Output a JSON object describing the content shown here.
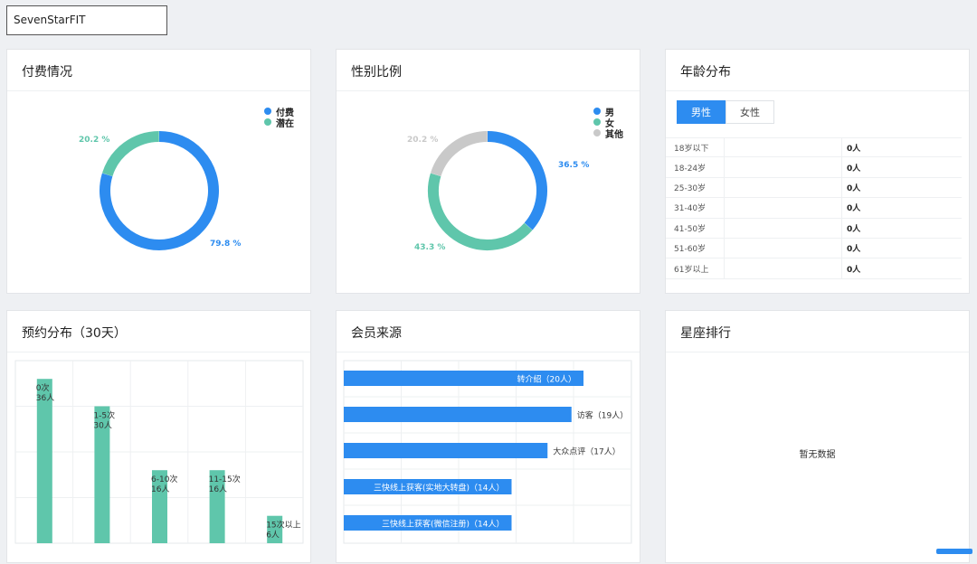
{
  "app": {
    "name": "SevenStarFIT"
  },
  "colors": {
    "blue": "#2d8cf0",
    "teal": "#5fc6ab",
    "gray": "#c9c9c9"
  },
  "payment": {
    "title": "付费情况",
    "legend": [
      {
        "label": "付费",
        "color": "#2d8cf0"
      },
      {
        "label": "潜在",
        "color": "#5fc6ab"
      }
    ],
    "labels": {
      "paid": "79.8 %",
      "potential": "20.2 %"
    },
    "chart_data": {
      "type": "pie",
      "categories": [
        "付费",
        "潜在"
      ],
      "values": [
        79.8,
        20.2
      ]
    }
  },
  "gender": {
    "title": "性别比例",
    "legend": [
      {
        "label": "男",
        "color": "#2d8cf0"
      },
      {
        "label": "女",
        "color": "#5fc6ab"
      },
      {
        "label": "其他",
        "color": "#c9c9c9"
      }
    ],
    "labels": {
      "male": "36.5 %",
      "female": "43.3 %",
      "other": "20.2 %"
    },
    "chart_data": {
      "type": "pie",
      "categories": [
        "男",
        "女",
        "其他"
      ],
      "values": [
        36.5,
        43.3,
        20.2
      ]
    }
  },
  "age": {
    "title": "年龄分布",
    "tabs": [
      {
        "label": "男性",
        "active": true
      },
      {
        "label": "女性",
        "active": false
      }
    ],
    "rows": [
      {
        "range": "18岁以下",
        "count": "0人"
      },
      {
        "range": "18-24岁",
        "count": "0人"
      },
      {
        "range": "25-30岁",
        "count": "0人"
      },
      {
        "range": "31-40岁",
        "count": "0人"
      },
      {
        "range": "41-50岁",
        "count": "0人"
      },
      {
        "range": "51-60岁",
        "count": "0人"
      },
      {
        "range": "61岁以上",
        "count": "0人"
      }
    ]
  },
  "booking": {
    "title": "预约分布（30天）",
    "chart_data": {
      "type": "bar",
      "categories": [
        "0次",
        "1-5次",
        "6-10次",
        "11-15次",
        "15次以上"
      ],
      "values": [
        36,
        30,
        16,
        16,
        6
      ],
      "value_labels": [
        "36人",
        "30人",
        "16人",
        "16人",
        "6人"
      ],
      "ylim": [
        0,
        40
      ]
    }
  },
  "source": {
    "title": "会员来源",
    "chart_data": {
      "type": "bar",
      "orientation": "horizontal",
      "categories": [
        "转介绍",
        "访客",
        "大众点评",
        "三快线上获客(实地大转盘)",
        "三快线上获客(微信注册)"
      ],
      "values": [
        20,
        19,
        17,
        14,
        14
      ],
      "value_labels": [
        "转介绍（20人）",
        "访客（19人）",
        "大众点评（17人）",
        "三快线上获客(实地大转盘)（14人）",
        "三快线上获客(微信注册)（14人）"
      ],
      "xlim": [
        0,
        24
      ]
    }
  },
  "constellation": {
    "title": "星座排行",
    "empty_text": "暂无数据"
  }
}
